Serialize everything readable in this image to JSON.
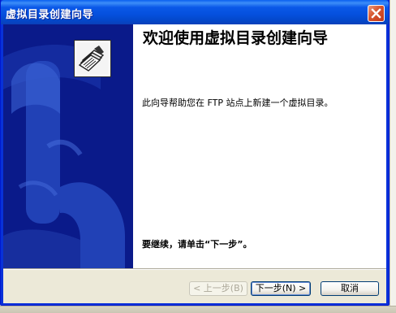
{
  "window": {
    "title": "虚拟目录创建向导",
    "close_icon": "close-icon"
  },
  "wizard": {
    "heading": "欢迎使用虚拟目录创建向导",
    "description": "此向导帮助您在 FTP 站点上新建一个虚拟目录。",
    "continue_prompt": "要继续，请单击“下一步”。",
    "icon": "wizard-document-icon"
  },
  "buttons": {
    "back": {
      "label": "< 上一步(B)",
      "enabled": false
    },
    "next": {
      "label": "下一步(N) >",
      "enabled": true,
      "default": true
    },
    "cancel": {
      "label": "取消",
      "enabled": true
    }
  },
  "colors": {
    "titlebar": "#0a58e8",
    "sidebar": "#0a1a8a",
    "content_bg": "#ffffff",
    "dialog_bg": "#ece9d8"
  }
}
